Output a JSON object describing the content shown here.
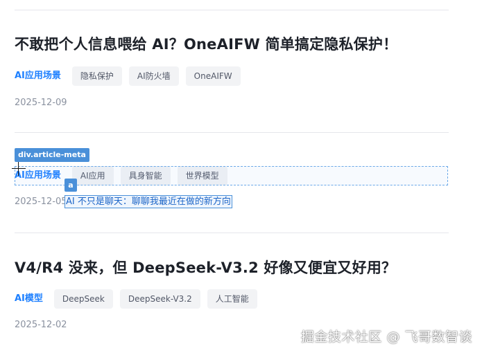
{
  "articles": [
    {
      "title": "不敢把个人信息喂给 AI？OneAIFW 简单搞定隐私保护！",
      "category": "AI应用场景",
      "tags": [
        "隐私保护",
        "AI防火墙",
        "OneAIFW"
      ],
      "date": "2025-12-09"
    },
    {
      "title": "AI 不只是聊天：聊聊我最近在做的新方向",
      "category": "AI应用场景",
      "tags": [
        "AI应用",
        "具身智能",
        "世界模型"
      ],
      "date": "2025-12-05"
    },
    {
      "title": "V4/R4 没来，但 DeepSeek-V3.2 好像又便宜又好用？",
      "category": "AI模型",
      "tags": [
        "DeepSeek",
        "DeepSeek-V3.2",
        "人工智能"
      ],
      "date": "2025-12-02"
    }
  ],
  "inspector": {
    "element_label": "div.article-meta",
    "link_badge": "a"
  },
  "watermark": "掘金技术社区 @ 飞哥数智谈"
}
